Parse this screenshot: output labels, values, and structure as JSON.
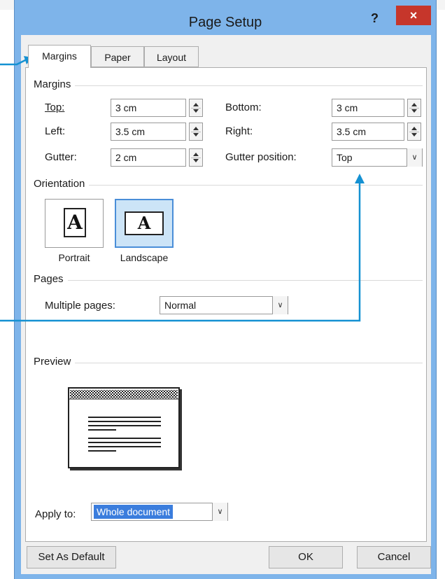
{
  "window": {
    "title": "Page Setup",
    "help": "?",
    "close": "×"
  },
  "tabs": [
    {
      "label": "Margins",
      "active": true
    },
    {
      "label": "Paper",
      "active": false
    },
    {
      "label": "Layout",
      "active": false
    }
  ],
  "margins": {
    "section": "Margins",
    "top": {
      "label": "Top:",
      "value": "3 cm"
    },
    "left": {
      "label": "Left:",
      "value": "3.5 cm"
    },
    "gutter": {
      "label": "Gutter:",
      "value": "2 cm"
    },
    "bottom": {
      "label": "Bottom:",
      "value": "3 cm"
    },
    "right": {
      "label": "Right:",
      "value": "3.5 cm"
    },
    "gutter_position": {
      "label": "Gutter position:",
      "value": "Top"
    }
  },
  "orientation": {
    "section": "Orientation",
    "portrait": {
      "label": "Portrait",
      "glyph": "A",
      "selected": false
    },
    "landscape": {
      "label": "Landscape",
      "glyph": "A",
      "selected": true
    }
  },
  "pages": {
    "section": "Pages",
    "multiple_label": "Multiple pages:",
    "multiple_value": "Normal"
  },
  "preview": {
    "section": "Preview"
  },
  "apply": {
    "label": "Apply to:",
    "value": "Whole document"
  },
  "buttons": {
    "default": "Set As Default",
    "ok": "OK",
    "cancel": "Cancel"
  },
  "colors": {
    "frame": "#7eb4ea",
    "close": "#c6362b",
    "selection": "#3b7ddd",
    "callout": "#1591d2"
  }
}
